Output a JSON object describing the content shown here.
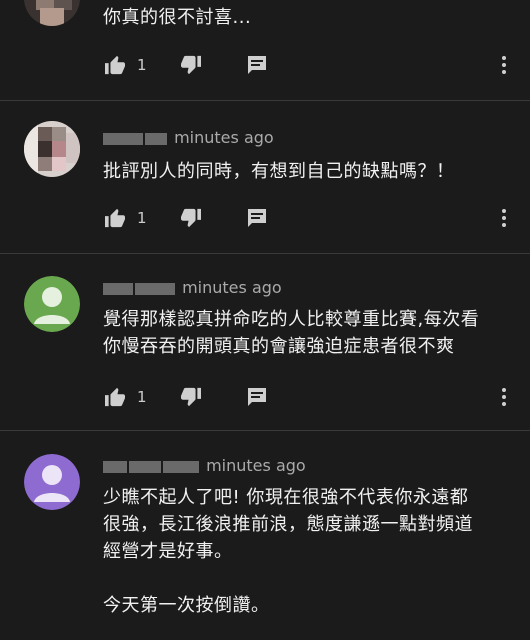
{
  "comments": [
    {
      "author": "",
      "time": "",
      "text_lines": [
        "你真的很不討喜..."
      ],
      "likes": "1",
      "avatar": "photo"
    },
    {
      "author": "",
      "time": "minutes ago",
      "text_lines": [
        "批評別人的同時，有想到自己的缺點嗎？！"
      ],
      "likes": "1",
      "avatar": "photo"
    },
    {
      "author": "",
      "time": "minutes ago",
      "text_lines": [
        "覺得那樣認真拼命吃的人比較尊重比賽,每次看",
        "你慢吞吞的開頭真的會讓強迫症患者很不爽"
      ],
      "likes": "1",
      "avatar": "default-green"
    },
    {
      "author": "",
      "time": "minutes ago",
      "text_lines": [
        "少瞧不起人了吧! 你現在很強不代表你永遠都",
        "很強，長江後浪推前浪，態度謙遜一點對頻道",
        "經營才是好事。",
        "",
        "今天第一次按倒讚。"
      ],
      "likes": "",
      "avatar": "default-purple"
    }
  ],
  "colors": {
    "background": "#1b1b1b",
    "text": "#f1f1f1",
    "meta": "#aaaaaa",
    "separator": "#3a3a3a",
    "avatar_green": "#6aa84f",
    "avatar_purple": "#8e6bd0"
  },
  "icons": {
    "like": "thumb-up-icon",
    "dislike": "thumb-down-icon",
    "reply": "reply-comment-icon",
    "menu": "more-vert-icon"
  }
}
